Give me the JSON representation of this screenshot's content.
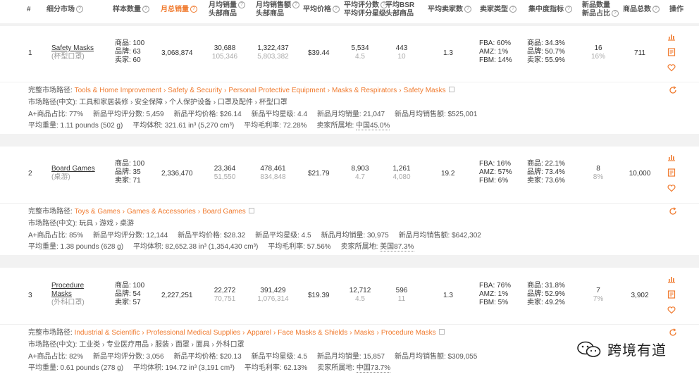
{
  "columns": {
    "index": "#",
    "market": "细分市场",
    "sample": "样本数量",
    "total_sales": "月总销量",
    "monthly_sales_l1": "月均销量",
    "monthly_sales_l2": "头部商品",
    "monthly_revenue_l1": "月均销售额",
    "monthly_revenue_l2": "头部商品",
    "avg_price": "平均价格",
    "avg_rating_l1": "平均评分数",
    "avg_rating_l2": "平均评分星级",
    "avg_bsr_l1": "平均BSR",
    "avg_bsr_l2": "头部商品",
    "avg_sellers": "平均卖家数",
    "seller_type": "卖家类型",
    "concentration": "集中度指标",
    "new_count_l1": "新品数量",
    "new_count_l2": "新品占比",
    "total_products": "商品总数",
    "actions": "操作"
  },
  "rows": [
    {
      "index": "1",
      "name": "Safety Masks",
      "name_cn": "(杯型口罩)",
      "sample": [
        "商品: 100",
        "品牌: 63",
        "卖家: 60"
      ],
      "total_sales": "3,068,874",
      "monthly_sales": "30,688",
      "monthly_sales_top": "105,346",
      "monthly_revenue": "1,322,437",
      "monthly_revenue_top": "5,803,382",
      "avg_price": "$39.44",
      "avg_rating_count": "5,534",
      "avg_rating_star": "4.5",
      "avg_bsr": "443",
      "avg_bsr_top": "10",
      "avg_sellers": "1.3",
      "seller_type": [
        "FBA: 60%",
        "AMZ: 1%",
        "FBM: 14%"
      ],
      "concentration": [
        "商品: 34.3%",
        "品牌: 50.7%",
        "卖家: 55.9%"
      ],
      "new_count": "16",
      "new_ratio": "16%",
      "total_products": "711",
      "detail": {
        "path_label": "完整市场路径:",
        "path": [
          "Tools & Home Improvement",
          "Safety & Security",
          "Personal Protective Equipment",
          "Masks & Respirators",
          "Safety Masks"
        ],
        "path_cn": "市场路径(中文): 工具和家居装修 › 安全保障 › 个人保护设备 › 口罩及配件 › 杯型口罩",
        "aplus": "A+商品占比: 77%",
        "new_rating_count": "新品平均评分数: 5,459",
        "new_avg_price": "新品平均价格: $26.14",
        "new_avg_star": "新品平均星级: 4.4",
        "new_monthly_sales": "新品月均销量: 21,047",
        "new_monthly_revenue": "新品月均销售额: $525,001",
        "avg_weight": "平均重量: 1.11 pounds (502 g)",
        "avg_volume": "平均体积: 321.61 in³ (5,270 cm³)",
        "avg_margin": "平均毛利率: 72.28%",
        "seller_origin_label": "卖家所属地:",
        "seller_origin_value": "中国45.0%"
      }
    },
    {
      "index": "2",
      "name": "Board Games",
      "name_cn": "(桌游)",
      "sample": [
        "商品: 100",
        "品牌: 35",
        "卖家: 71"
      ],
      "total_sales": "2,336,470",
      "monthly_sales": "23,364",
      "monthly_sales_top": "51,550",
      "monthly_revenue": "478,461",
      "monthly_revenue_top": "834,848",
      "avg_price": "$21.79",
      "avg_rating_count": "8,903",
      "avg_rating_star": "4.7",
      "avg_bsr": "1,261",
      "avg_bsr_top": "4,080",
      "avg_sellers": "19.2",
      "seller_type": [
        "FBA: 16%",
        "AMZ: 57%",
        "FBM: 6%"
      ],
      "concentration": [
        "商品: 22.1%",
        "品牌: 73.4%",
        "卖家: 73.6%"
      ],
      "new_count": "8",
      "new_ratio": "8%",
      "total_products": "10,000",
      "detail": {
        "path_label": "完整市场路径:",
        "path": [
          "Toys & Games",
          "Games & Accessories",
          "Board Games"
        ],
        "path_cn": "市场路径(中文): 玩具 › 游戏 › 桌游",
        "aplus": "A+商品占比: 85%",
        "new_rating_count": "新品平均评分数: 12,144",
        "new_avg_price": "新品平均价格: $28.32",
        "new_avg_star": "新品平均星级: 4.5",
        "new_monthly_sales": "新品月均销量: 30,975",
        "new_monthly_revenue": "新品月均销售额: $642,302",
        "avg_weight": "平均重量: 1.38 pounds (628 g)",
        "avg_volume": "平均体积: 82,652.38 in³ (1,354,430 cm³)",
        "avg_margin": "平均毛利率: 57.56%",
        "seller_origin_label": "卖家所属地:",
        "seller_origin_value": "美国87.3%"
      }
    },
    {
      "index": "3",
      "name": "Procedure Masks",
      "name_line1": "Procedure",
      "name_line2": "Masks",
      "name_cn": "(外科口罩)",
      "sample": [
        "商品: 100",
        "品牌: 54",
        "卖家: 57"
      ],
      "total_sales": "2,227,251",
      "monthly_sales": "22,272",
      "monthly_sales_top": "70,751",
      "monthly_revenue": "391,429",
      "monthly_revenue_top": "1,076,314",
      "avg_price": "$19.39",
      "avg_rating_count": "12,712",
      "avg_rating_star": "4.5",
      "avg_bsr": "596",
      "avg_bsr_top": "11",
      "avg_sellers": "1.3",
      "seller_type": [
        "FBA: 76%",
        "AMZ: 1%",
        "FBM: 5%"
      ],
      "concentration": [
        "商品: 31.8%",
        "品牌: 52.9%",
        "卖家: 49.2%"
      ],
      "new_count": "7",
      "new_ratio": "7%",
      "total_products": "3,902",
      "detail": {
        "path_label": "完整市场路径:",
        "path": [
          "Industrial & Scientific",
          "Professional Medical Supplies",
          "Apparel",
          "Face Masks & Shields",
          "Masks",
          "Procedure Masks"
        ],
        "path_cn": "市场路径(中文): 工业类 › 专业医疗用品 › 服装 › 面罩 › 面具 › 外科口罩",
        "aplus": "A+商品占比: 82%",
        "new_rating_count": "新品平均评分数: 3,056",
        "new_avg_price": "新品平均价格: $20.13",
        "new_avg_star": "新品平均星级: 4.5",
        "new_monthly_sales": "新品月均销量: 15,857",
        "new_monthly_revenue": "新品月均销售额: $309,055",
        "avg_weight": "平均重量: 0.61 pounds (278 g)",
        "avg_volume": "平均体积: 194.72 in³ (3,191 cm³)",
        "avg_margin": "平均毛利率: 62.13%",
        "seller_origin_label": "卖家所属地:",
        "seller_origin_value": "中国73.7%"
      }
    }
  ],
  "watermark": "跨境有道",
  "colors": {
    "accent": "#f07a2e",
    "gap": "#f2f2f2",
    "muted": "#aaaaaa"
  },
  "icons": [
    "chart-icon",
    "document-icon",
    "heart-icon",
    "refresh-icon",
    "external-link-icon",
    "help-icon"
  ]
}
